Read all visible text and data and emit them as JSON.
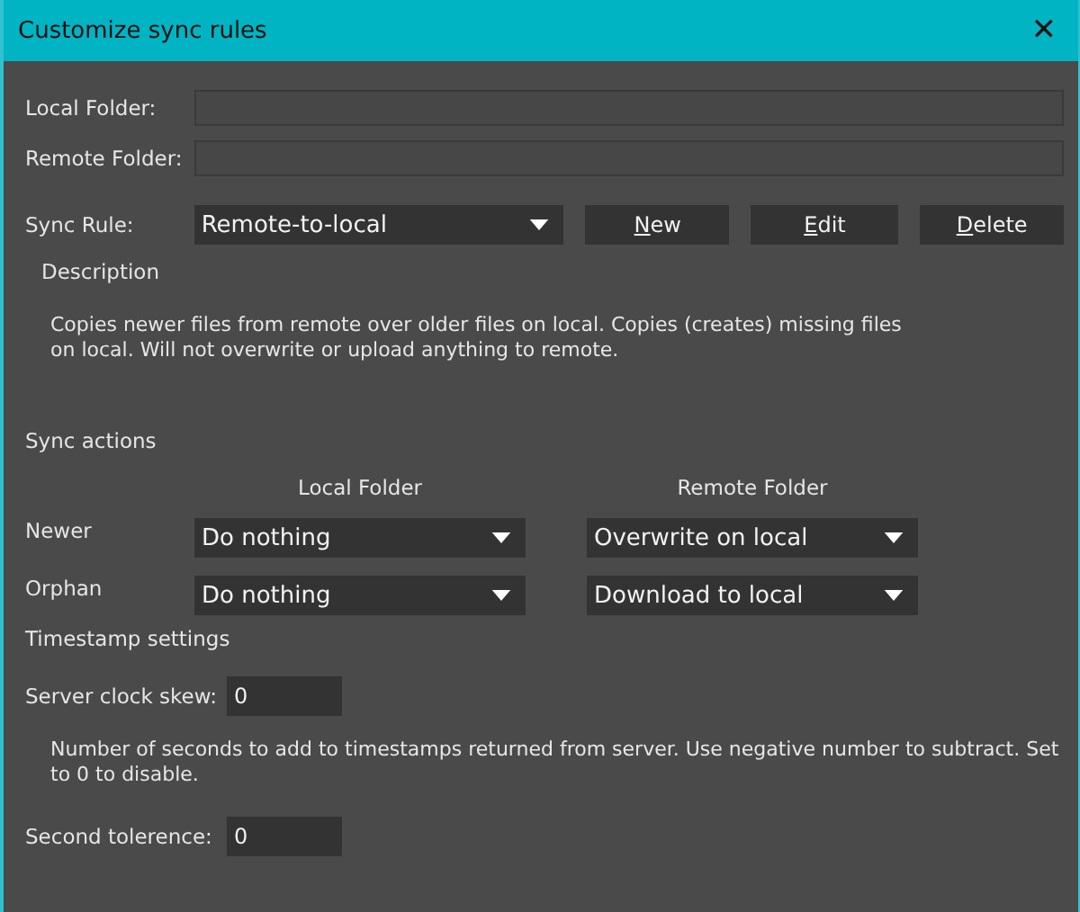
{
  "window": {
    "title": "Customize sync rules",
    "close": "✕"
  },
  "folders": [
    {
      "label": "Local Folder:"
    },
    {
      "label": "Remote Folder:"
    }
  ],
  "sync_rule": {
    "label": "Sync Rule:",
    "value": "Remote-to-local",
    "buttons": [
      "New",
      "Edit",
      "Delete"
    ]
  },
  "description": {
    "label": "Description",
    "text": "Copies newer files from remote over older files on local. Copies (creates) missing files on local. Will not overwrite or upload anything to remote."
  },
  "sync_actions": {
    "label": "Sync actions",
    "columns": [
      "Local Folder",
      "Remote Folder"
    ],
    "rows": [
      {
        "label": "Newer",
        "local": "Do nothing",
        "remote": "Overwrite on local"
      },
      {
        "label": "Orphan",
        "local": "Do nothing",
        "remote": "Download to local"
      }
    ]
  },
  "timestamp": {
    "label": "Timestamp settings",
    "fields": [
      {
        "label": "Server clock skew:",
        "value": "0",
        "help": "Number of seconds to add to timestamps returned from server. Use negative number to subtract. Set to 0 to disable."
      },
      {
        "label": "Second tolerence:",
        "value": "0"
      }
    ]
  }
}
